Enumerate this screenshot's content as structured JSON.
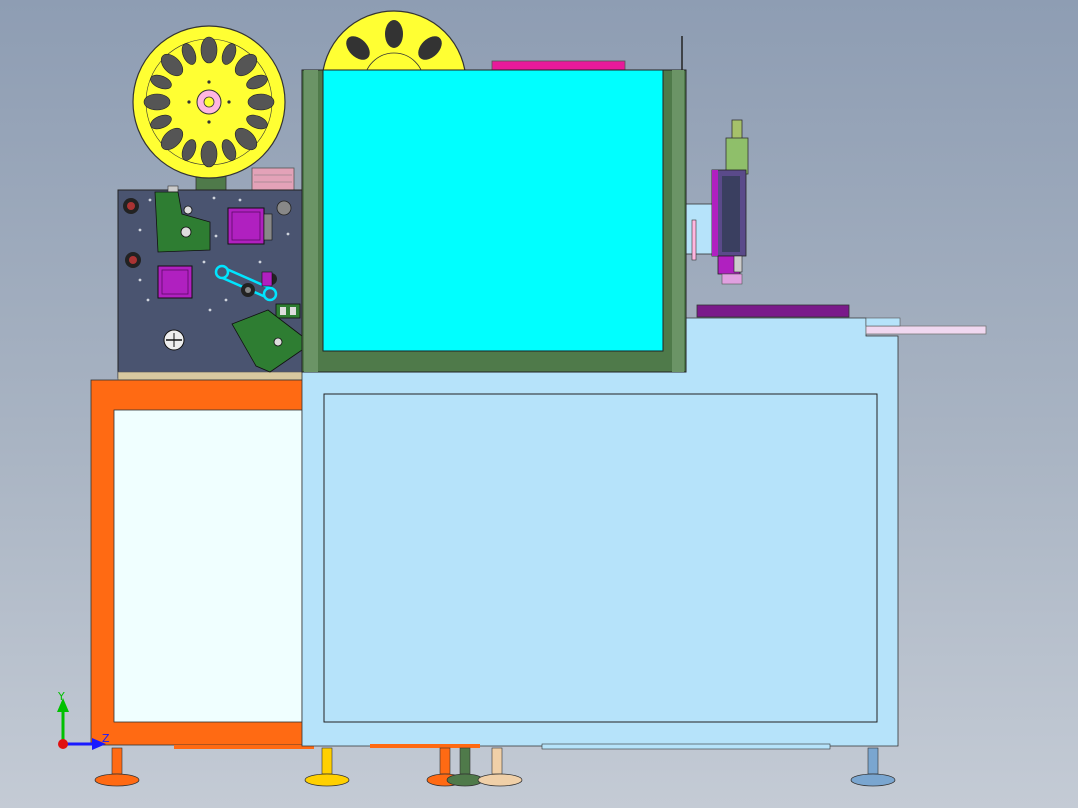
{
  "viewport": {
    "background_top": "#8e9db3",
    "background_bottom": "#c4cbd5"
  },
  "axis_triad": {
    "y_label": "Y",
    "z_label": "Z",
    "y_color": "#00c000",
    "z_color": "#1a1aff",
    "x_color": "#e01010"
  },
  "colors": {
    "reel": "#ffff33",
    "hub": "#ffb6e0",
    "control_panel": "#4a5470",
    "green_bracket": "#2e7d32",
    "purple_motor": "#b020c0",
    "cyan_window": "#00ffff",
    "dark_green_frame": "#4f7a4a",
    "cabinet_light_blue": "#b6e3fa",
    "orange_frame": "#ff6a13",
    "orange_panel": "#f0ffff",
    "magenta_top": "#e81a9a",
    "purple_plate": "#7a1a8a"
  },
  "icons": {
    "left_reel": "reel-icon",
    "right_reel": "reel-icon",
    "axis": "coordinate-axis-icon"
  }
}
